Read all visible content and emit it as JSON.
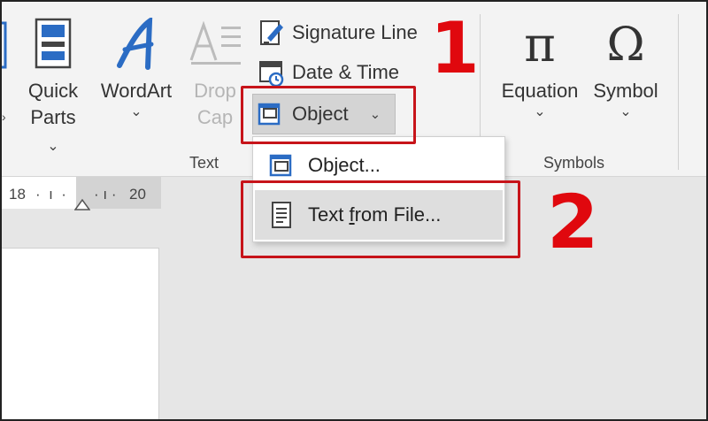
{
  "ribbon": {
    "text_group": {
      "label": "Text",
      "quick_parts": {
        "line1": "Quick",
        "line2": "Parts",
        "chevron": "⌄"
      },
      "wordart": {
        "label": "WordArt",
        "chevron": "⌄"
      },
      "drop_cap": {
        "line1": "Drop",
        "line2": "Cap",
        "chevron": "⌄"
      },
      "signature_line": "Signature Line",
      "date_time": "Date & Time",
      "object": {
        "label": "Object",
        "chevron": "⌄"
      }
    },
    "symbols_group": {
      "label": "Symbols",
      "equation": {
        "label": "Equation",
        "glyph": "π",
        "chevron": "⌄"
      },
      "symbol": {
        "label": "Symbol",
        "glyph": "Ω",
        "chevron": "⌄"
      }
    }
  },
  "ruler": {
    "left_mark": "18",
    "right_mark": "20"
  },
  "dropdown": {
    "items": [
      {
        "label": "Object...",
        "icon": "object-icon"
      },
      {
        "label_pre": "Text ",
        "label_accel": "f",
        "label_post": "rom File...",
        "icon": "text-file-icon"
      }
    ]
  },
  "annotations": {
    "step1": "1",
    "step2": "2",
    "highlight_color": "#c7141a"
  },
  "colors": {
    "accent_blue": "#2b6cc4",
    "ribbon_bg": "#f3f3f3"
  }
}
